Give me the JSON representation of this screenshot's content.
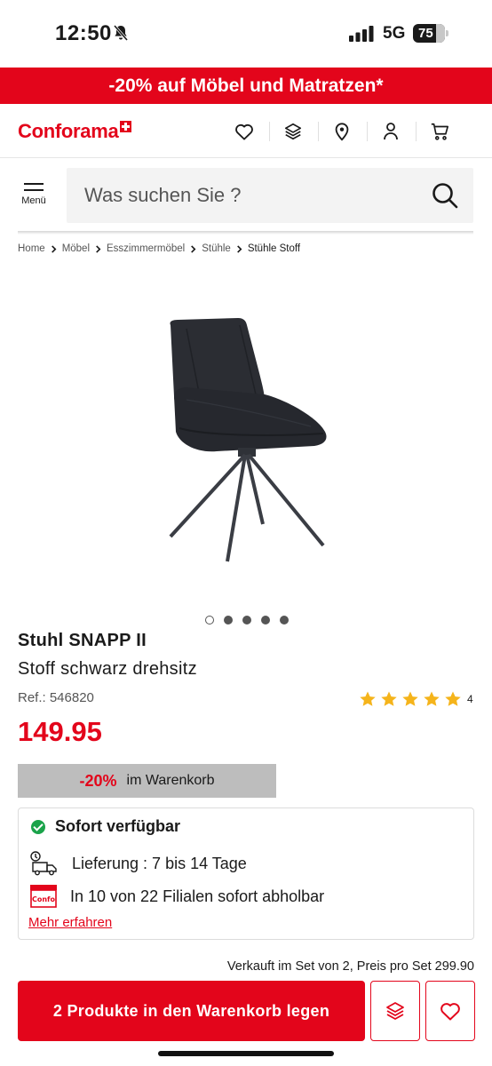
{
  "status_bar": {
    "time": "12:50",
    "network": "5G",
    "battery": "75"
  },
  "promo": {
    "text": "-20% auf Möbel und Matratzen*"
  },
  "header": {
    "logo": "Conforama",
    "icons": [
      "heart-icon",
      "layers-icon",
      "location-pin-icon",
      "user-icon",
      "cart-icon"
    ]
  },
  "search": {
    "menu_label": "Menü",
    "placeholder": "Was suchen Sie ?"
  },
  "breadcrumb": [
    "Home",
    "Möbel",
    "Esszimmermöbel",
    "Stühle",
    "Stühle Stoff"
  ],
  "gallery": {
    "image_count": 5,
    "active_index": 0
  },
  "product": {
    "title": "Stuhl SNAPP II",
    "subtitle": "Stoff schwarz drehsitz",
    "ref": "Ref.: 546820",
    "rating": 5,
    "review_count": "4",
    "price": "149.95",
    "discount_pct": "-20%",
    "discount_text": "im Warenkorb"
  },
  "availability": {
    "status": "Sofort verfügbar",
    "delivery": "Lieferung : 7 bis 14 Tage",
    "pickup": "In 10 von 22 Filialen sofort abholbar",
    "more_link": "Mehr erfahren",
    "store_icon_label": "Confo"
  },
  "purchase": {
    "set_info": "Verkauft im Set von 2, Preis pro Set 299.90",
    "cart_button": "2 Produkte in den Warenkorb legen"
  },
  "colors": {
    "brand_red": "#e3051b",
    "success_green": "#1aa34a",
    "star_yellow": "#f5b41b"
  }
}
